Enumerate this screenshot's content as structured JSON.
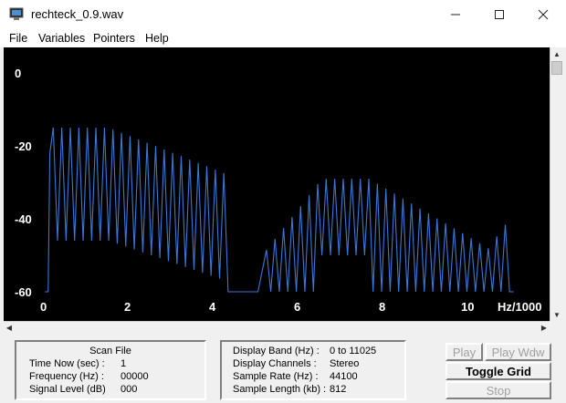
{
  "window": {
    "title": "rechteck_0.9.wav"
  },
  "menu": [
    "File",
    "Variables",
    "Pointers",
    "Help"
  ],
  "plot": {
    "y_ticks": [
      "0",
      "-20",
      "-40",
      "-60"
    ],
    "x_ticks": [
      "0",
      "2",
      "4",
      "6",
      "8",
      "10"
    ],
    "x_unit": "Hz/1000",
    "line_color": "#3a78d8"
  },
  "chart_data": {
    "type": "line",
    "xlabel": "Hz/1000",
    "ylabel": "",
    "xlim": [
      0,
      11.025
    ],
    "ylim": [
      -60,
      0
    ],
    "series": [
      {
        "values": "spectrum of a square wave: harmonic peaks about every 0.2 kHz, first lobe peaking near -15 dB around 0.3-1.5 kHz and decaying to about -28 dB by 4.3 kHz, signal near -60 dB from 4.5 to 5.1 kHz, second lobe rising to about -29 dB around 6.5-7.6 kHz and falling to about -48 dB by 10.4 kHz, small rise to about -38 dB near 11 kHz"
      }
    ]
  },
  "left_panel": {
    "title": "Scan File",
    "rows": [
      {
        "label": "Time Now (sec) :",
        "value": "1"
      },
      {
        "label": "Frequency (Hz) :",
        "value": "00000"
      },
      {
        "label": "Signal Level (dB)",
        "value": "000"
      }
    ]
  },
  "right_panel": {
    "rows": [
      {
        "label": "Display Band (Hz) :",
        "value": "0 to 11025"
      },
      {
        "label": "Display Channels :",
        "value": "Stereo"
      },
      {
        "label": "Sample Rate (Hz) :",
        "value": "44100"
      },
      {
        "label": "Sample Length (kb) :",
        "value": "812"
      }
    ]
  },
  "buttons": {
    "play": "Play",
    "play_wdw": "Play Wdw",
    "toggle_grid": "Toggle Grid",
    "stop": "Stop"
  }
}
